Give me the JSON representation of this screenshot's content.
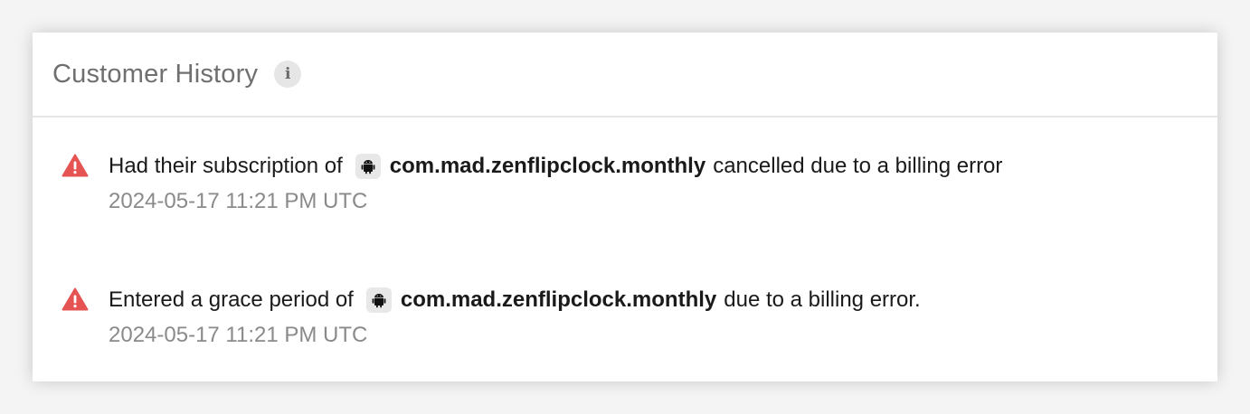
{
  "card": {
    "title": "Customer History",
    "info_icon": "info-icon",
    "info_glyph": "i"
  },
  "events": [
    {
      "icon": "warning-triangle-icon",
      "prefix": "Had their subscription of",
      "platform_icon": "android-icon",
      "product": "com.mad.zenflipclock.monthly",
      "suffix": "cancelled due to a billing error",
      "time": "2024-05-17 11:21 PM UTC"
    },
    {
      "icon": "warning-triangle-icon",
      "prefix": "Entered a grace period of",
      "platform_icon": "android-icon",
      "product": "com.mad.zenflipclock.monthly",
      "suffix": "due to a billing error.",
      "time": "2024-05-17 11:21 PM UTC"
    }
  ],
  "colors": {
    "warning": "#e55353",
    "title": "#6f6f6f",
    "timestamp": "#8a8a8a"
  }
}
